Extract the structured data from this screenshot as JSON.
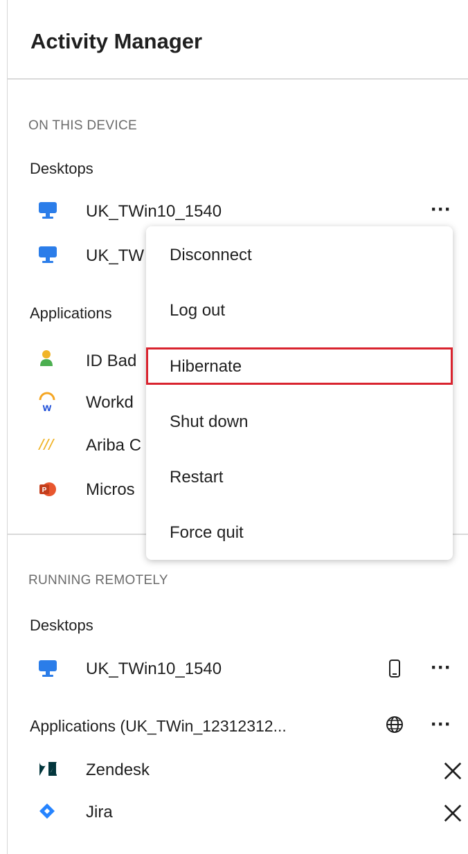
{
  "header": {
    "title": "Activity Manager"
  },
  "on_device": {
    "section_label": "ON THIS DEVICE",
    "desktops_label": "Desktops",
    "desktops": [
      {
        "name": "UK_TWin10_1540"
      },
      {
        "name": "UK_TW"
      }
    ],
    "applications_label": "Applications",
    "applications": [
      {
        "name": "ID Bad",
        "icon": "id-badge-icon"
      },
      {
        "name": "Workd",
        "icon": "workday-icon"
      },
      {
        "name": "Ariba C",
        "icon": "ariba-icon"
      },
      {
        "name": "Micros",
        "icon": "powerpoint-icon"
      }
    ]
  },
  "context_menu": {
    "items": [
      {
        "label": "Disconnect"
      },
      {
        "label": "Log out"
      },
      {
        "label": "Hibernate",
        "highlighted": true
      },
      {
        "label": "Shut down"
      },
      {
        "label": "Restart"
      },
      {
        "label": "Force quit"
      }
    ],
    "highlight_color": "#d9232e"
  },
  "remote": {
    "section_label": "RUNNING REMOTELY",
    "desktops_label": "Desktops",
    "desktops": [
      {
        "name": "UK_TWin10_1540",
        "status_icon": "mobile-device-icon"
      }
    ],
    "applications_label": "Applications (UK_TWin_12312312...",
    "applications_status_icon": "globe-icon",
    "applications": [
      {
        "name": "Zendesk",
        "icon": "zendesk-icon"
      },
      {
        "name": "Jira",
        "icon": "jira-icon"
      }
    ]
  },
  "colors": {
    "accent_blue": "#2b7de9",
    "text": "#1f1f1f",
    "muted": "#6b6b6b"
  }
}
